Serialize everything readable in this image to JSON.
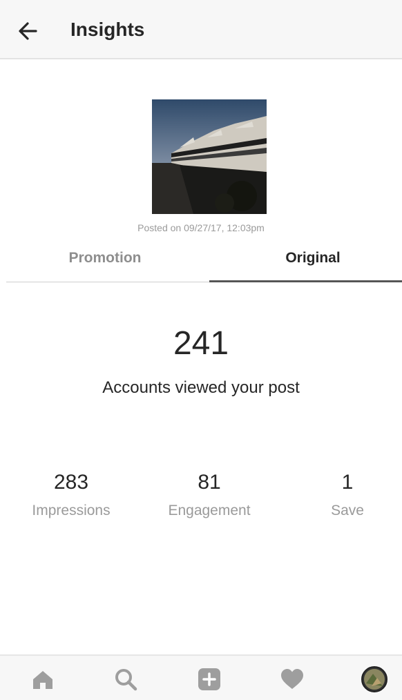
{
  "header": {
    "title": "Insights"
  },
  "post": {
    "posted_text": "Posted on 09/27/17, 12:03pm"
  },
  "tabs": [
    {
      "label": "Promotion",
      "active": false
    },
    {
      "label": "Original",
      "active": true
    }
  ],
  "summary": {
    "value": "241",
    "label": "Accounts viewed your post"
  },
  "stats": [
    {
      "value": "283",
      "label": "Impressions"
    },
    {
      "value": "81",
      "label": "Engagement"
    },
    {
      "value": "1",
      "label": "Save"
    }
  ],
  "bottom_nav": {
    "icons": [
      "home-icon",
      "search-icon",
      "add-icon",
      "heart-icon",
      "profile-avatar"
    ],
    "icon_color": "#9e9e9e"
  },
  "colors": {
    "accent": "#262626",
    "muted": "#9a9a9a",
    "header_bg": "#f7f7f7"
  }
}
